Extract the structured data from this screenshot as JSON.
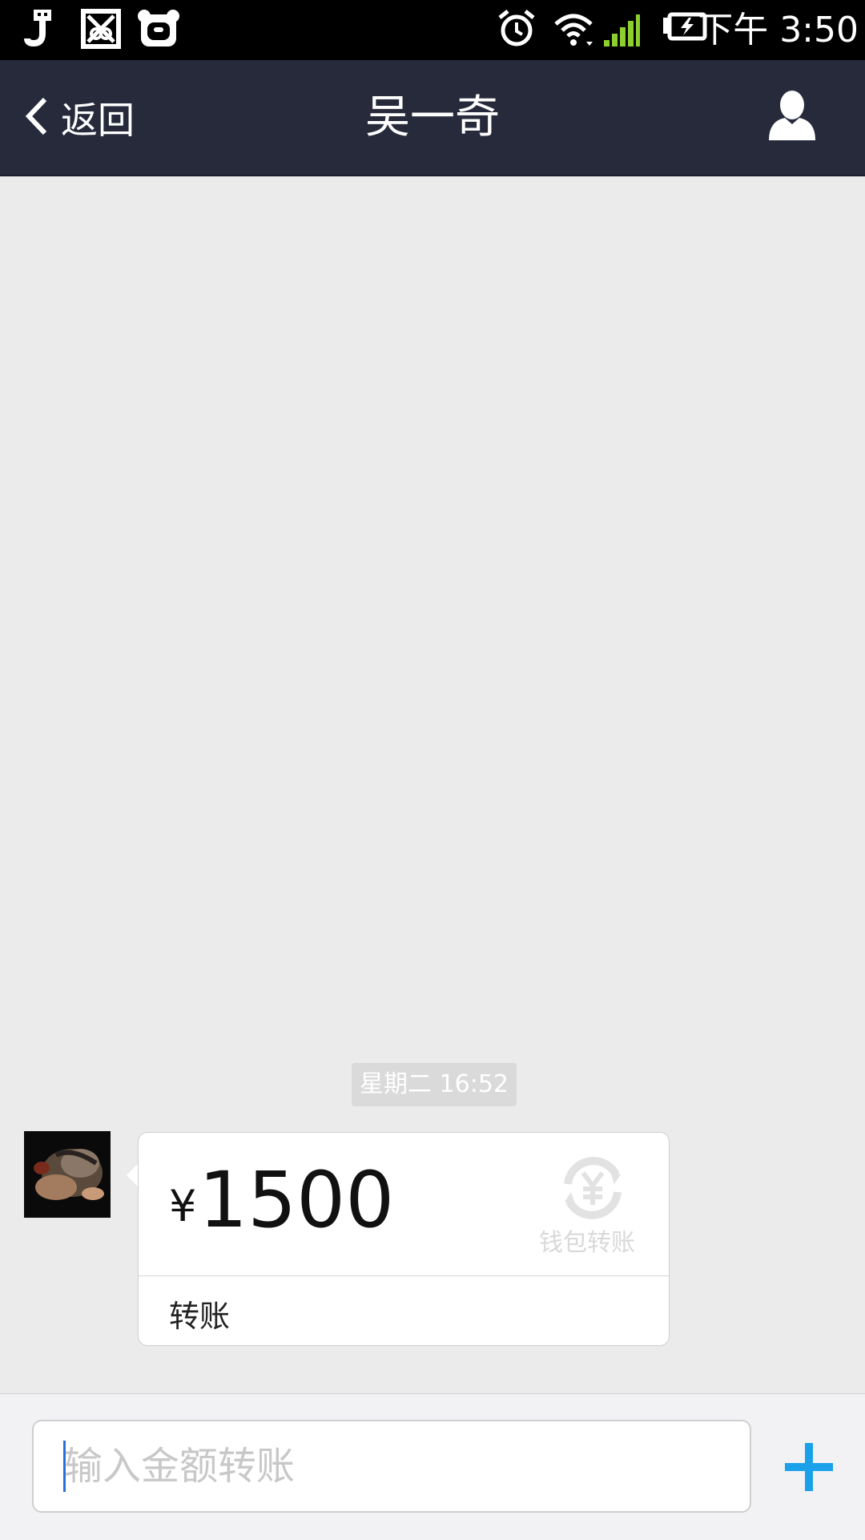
{
  "status_bar": {
    "time": "下午 3:50",
    "left_icons": [
      "usb-icon",
      "scissors-app-icon",
      "panda-app-icon"
    ],
    "right_icons": [
      "alarm-icon",
      "wifi-icon",
      "signal-icon",
      "battery-charging-icon"
    ],
    "signal_color": "#8ccf2f"
  },
  "nav": {
    "back_label": "返回",
    "title": "吴一奇",
    "profile_icon": "person-icon"
  },
  "chat": {
    "timestamp": "星期二 16:52",
    "message": {
      "currency_symbol": "¥",
      "amount": "1500",
      "badge_label": "钱包转账",
      "caption": "转账"
    }
  },
  "input_bar": {
    "placeholder": "输入金额转账",
    "value": "",
    "plus_color": "#1aa1ea"
  }
}
